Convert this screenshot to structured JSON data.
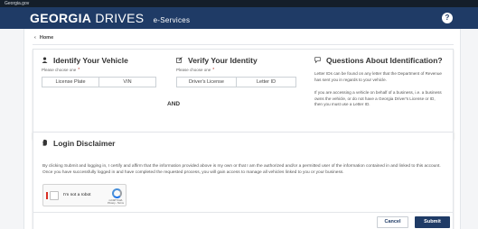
{
  "gov_bar": {
    "text": "Georgia.gov"
  },
  "brand": {
    "part1": "GEORGIA",
    "part2": "DRIVES",
    "part3": "e-Services",
    "help_glyph": "?"
  },
  "nav": {
    "home_label": "Home"
  },
  "identify_vehicle": {
    "title": "Identify Your Vehicle",
    "choose_label": "Please choose one",
    "required_mark": "*",
    "options": [
      "License Plate",
      "VIN"
    ]
  },
  "and_label": "AND",
  "verify_identity": {
    "title": "Verify Your Identity",
    "choose_label": "Please choose one",
    "required_mark": "*",
    "options": [
      "Driver's License",
      "Letter ID"
    ]
  },
  "questions": {
    "title": "Questions About Identification?",
    "paragraph1": "Letter IDs can be found on any letter that the Department of Revenue has sent you in regards to your vehicle.",
    "paragraph2": "If you are accessing a vehicle on behalf of a business, i.e. a business owns the vehicle, or do not have a Georgia Driver's License or ID, then you must use a Letter ID."
  },
  "disclaimer": {
    "title": "Login Disclaimer",
    "text": "By clicking Submit and logging in, I certify and affirm that the information provided above is my own or that I am the authorized and/or a permitted user of the information contained in and linked to this account. Once you have successfully logged in and have completed the requested process, you will gain access to manage all vehicles linked to you or your business."
  },
  "captcha": {
    "label": "I'm not a robot",
    "brand": "reCAPTCHA",
    "links": "Privacy - Terms"
  },
  "actions": {
    "cancel_label": "Cancel",
    "submit_label": "Submit"
  },
  "colors": {
    "navy": "#1f3b66",
    "gov_bar": "#141e2a",
    "required": "#c0392b"
  }
}
